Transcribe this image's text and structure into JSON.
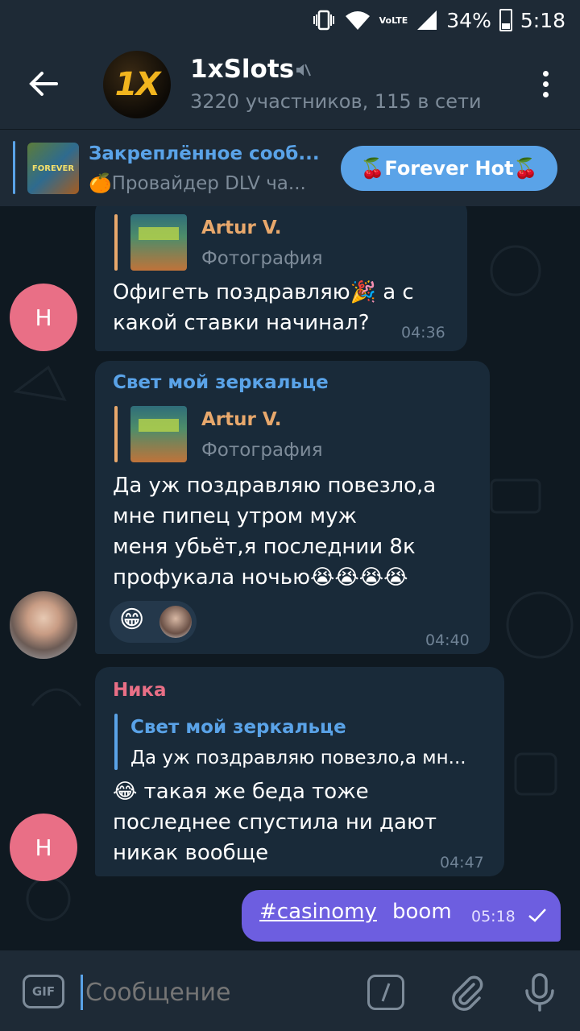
{
  "status_bar": {
    "volte": "VoLTE",
    "battery": "34%",
    "time": "5:18"
  },
  "header": {
    "avatar_text": "1X",
    "title": "1xSlots",
    "subtitle": "3220 участников, 115 в сети"
  },
  "pinned": {
    "title": "Закреплённое сооб...",
    "text": "🍊Провайдер DLV ча...",
    "button": "🍒Forever Hot🍒",
    "thumb_text": "FOREVER"
  },
  "messages": [
    {
      "reply_name": "Artur V.",
      "reply_text": "Фотография",
      "lines": [
        "Офигеть поздравляю🎉 а с",
        "какой ставки начинал?"
      ],
      "time": "04:36",
      "avatar_letter": "Н"
    },
    {
      "sender": "Свет мой зеркальце",
      "reply_name": "Artur V.",
      "reply_text": "Фотография",
      "lines": [
        "Да уж поздравляю повезло,а",
        "мне пипец утром муж",
        "меня убьёт,я последнии 8к",
        "профукала ночью😭😭😭😭"
      ],
      "reaction_emoji": "😁",
      "time": "04:40"
    },
    {
      "sender": "Ника",
      "reply_name": "Свет мой зеркальце",
      "reply_text": "Да уж поздравляю повезло,а мн...",
      "lines": [
        "😂 такая же беда тоже",
        "последнее спустила ни дают",
        "никак вообще"
      ],
      "time": "04:47",
      "avatar_letter": "Н"
    }
  ],
  "outgoing": {
    "hashtag": "#casinomy",
    "word": "boom",
    "time": "05:18"
  },
  "input": {
    "placeholder": "Сообщение",
    "gif_label": "GIF"
  },
  "colors": {
    "accent": "#5aa3e8",
    "outgoing": "#6d5ee0",
    "bubble": "#192a39",
    "nika": "#e96f86",
    "artur": "#e8a86c"
  }
}
